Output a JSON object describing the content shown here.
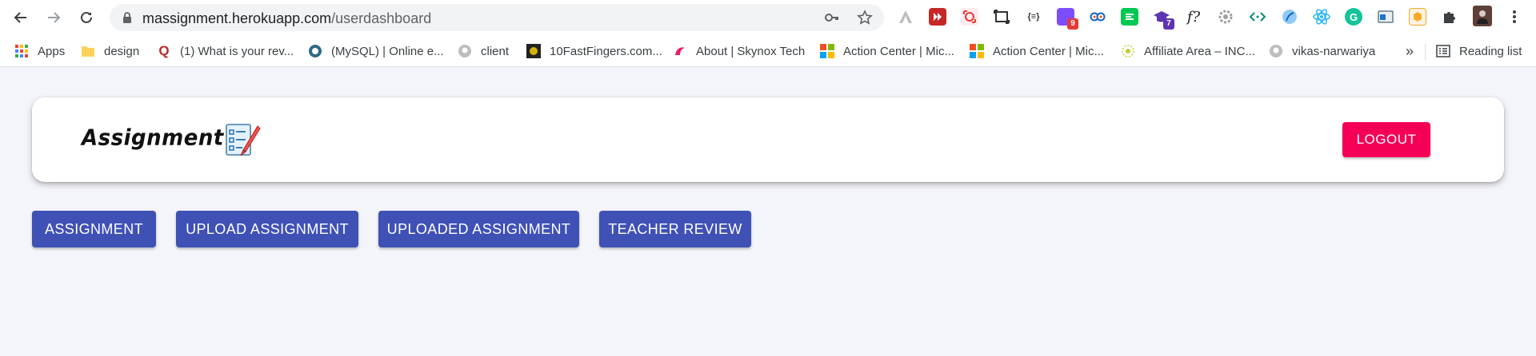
{
  "browser": {
    "url_host": "massignment.herokuapp.com",
    "url_path": "/userdashboard",
    "extensions": [
      {
        "icon": "adobe-icon"
      },
      {
        "icon": "video-downloader-icon",
        "color": "#c62828"
      },
      {
        "icon": "screen-capture-icon",
        "color": "#e53935"
      },
      {
        "icon": "screenshot-frame-icon"
      },
      {
        "icon": "json-formatter-icon"
      },
      {
        "icon": "purple-extension-icon",
        "badge": "9",
        "color": "#7c4dff"
      },
      {
        "icon": "owl-extension-icon"
      },
      {
        "icon": "green-extension-icon",
        "color": "#00c853"
      },
      {
        "icon": "graduation-cap-icon",
        "badge": "7",
        "color": "#5e35b1"
      },
      {
        "icon": "function-icon"
      },
      {
        "icon": "gear-extension-icon"
      },
      {
        "icon": "code-brackets-icon"
      },
      {
        "icon": "blue-feather-icon"
      },
      {
        "icon": "react-icon"
      },
      {
        "icon": "grammarly-icon",
        "color": "#15c39a"
      },
      {
        "icon": "window-extension-icon"
      },
      {
        "icon": "orange-extension-icon",
        "color": "#f9a825"
      },
      {
        "icon": "puzzle-icon"
      },
      {
        "icon": "profile-avatar-icon"
      },
      {
        "icon": "more-menu-icon"
      }
    ]
  },
  "bookmarks": {
    "items": [
      {
        "label": "Apps",
        "icon": "apps-grid-icon"
      },
      {
        "label": "design",
        "icon": "folder-icon"
      },
      {
        "label": "(1) What is your rev...",
        "icon": "quora-icon"
      },
      {
        "label": "(MySQL) | Online e...",
        "icon": "mysql-icon"
      },
      {
        "label": "client",
        "icon": "github-icon"
      },
      {
        "label": "10FastFingers.com...",
        "icon": "tenfastfingers-icon"
      },
      {
        "label": "About | Skynox Tech",
        "icon": "skynox-icon"
      },
      {
        "label": "Action Center | Mic...",
        "icon": "microsoft-icon"
      },
      {
        "label": "Action Center | Mic...",
        "icon": "microsoft-icon"
      },
      {
        "label": "Affiliate Area – INC...",
        "icon": "affiliate-icon"
      },
      {
        "label": "vikas-narwariya",
        "icon": "github-icon"
      }
    ],
    "overflow": "»",
    "reading_list": "Reading list"
  },
  "header": {
    "logo_text": "Assignment",
    "logout_label": "LOGOUT"
  },
  "nav": {
    "buttons": [
      {
        "label": "ASSIGNMENT"
      },
      {
        "label": "UPLOAD ASSIGNMENT"
      },
      {
        "label": "UPLOADED ASSIGNMENT"
      },
      {
        "label": "TEACHER REVIEW"
      }
    ]
  },
  "colors": {
    "primary": "#3f51b5",
    "secondary": "#f50057",
    "background": "#f4f5fa"
  }
}
